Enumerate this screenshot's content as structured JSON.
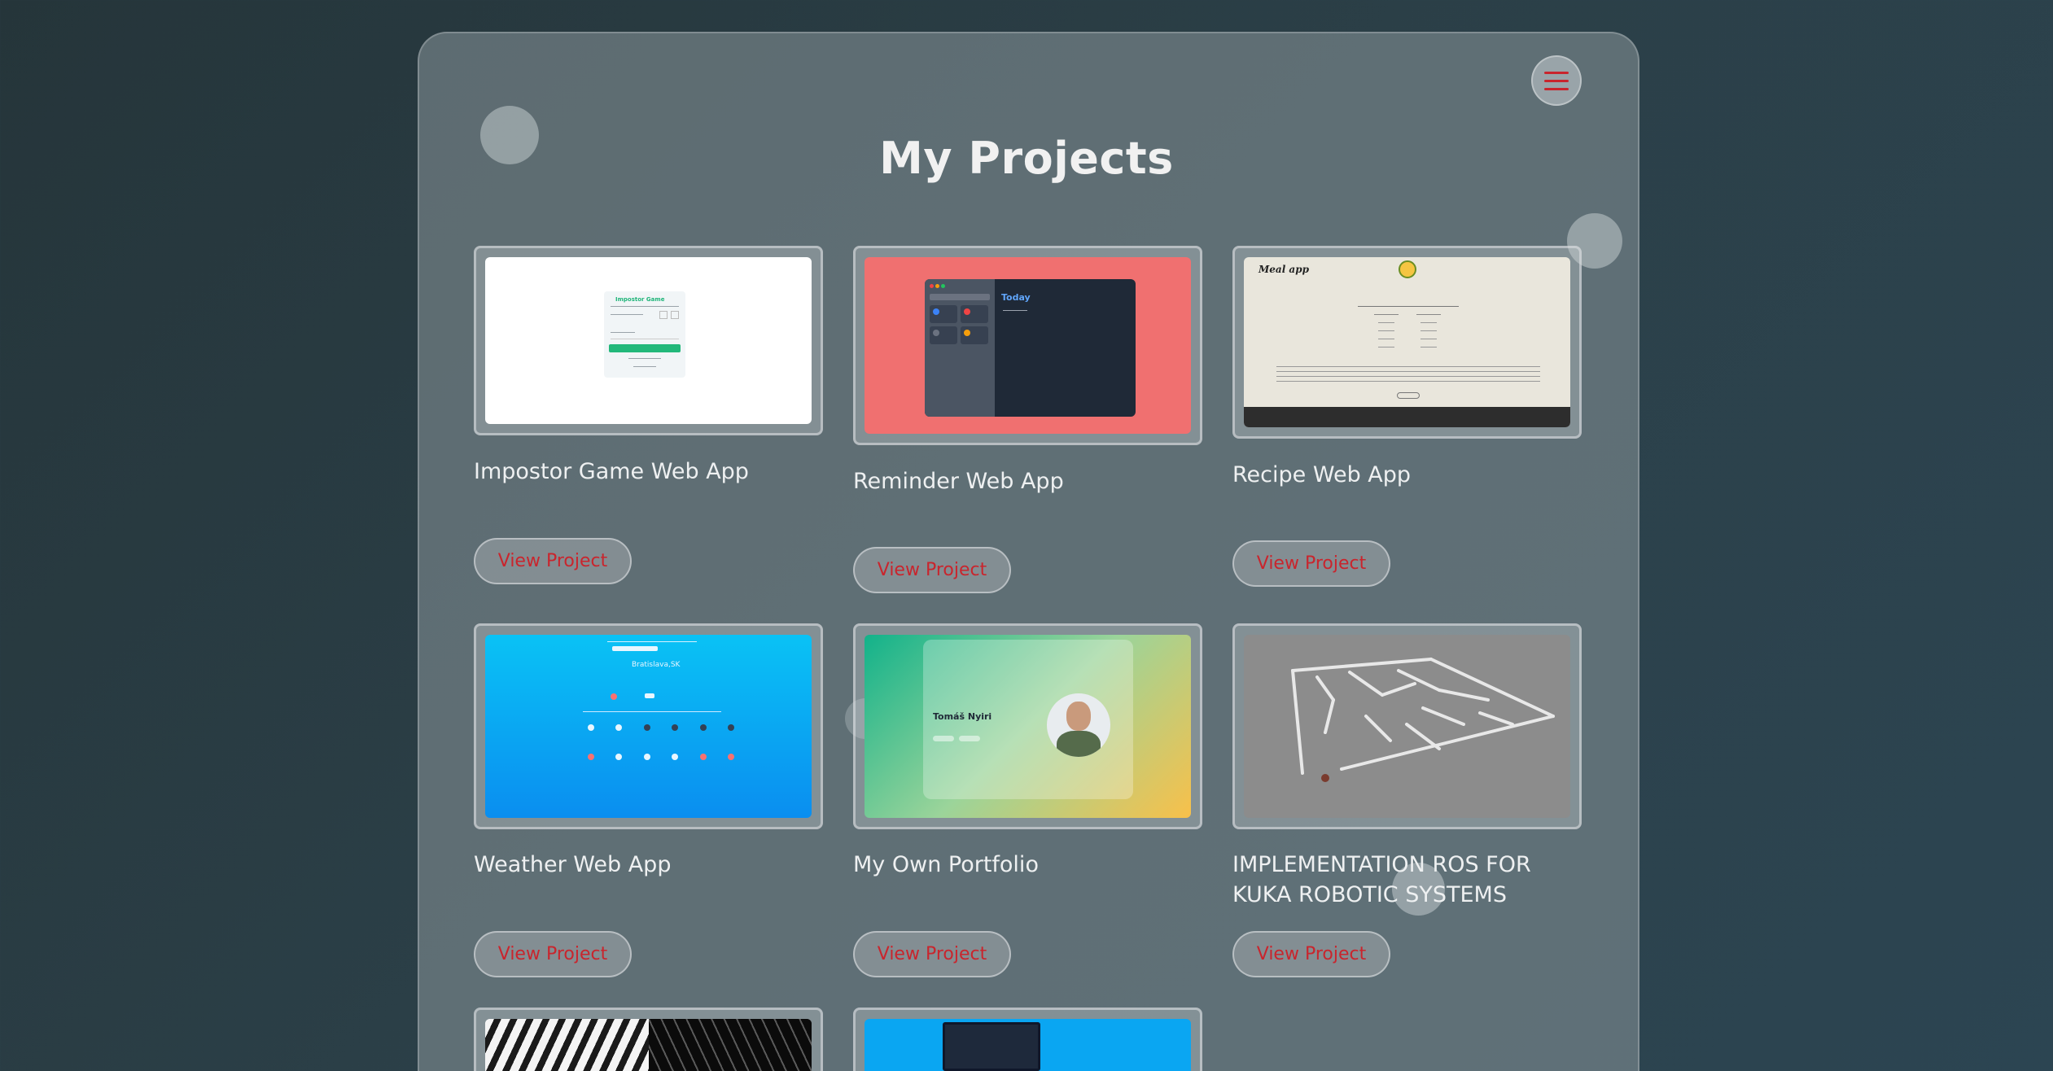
{
  "page": {
    "title": "My Projects"
  },
  "menu": {
    "icon": "hamburger-menu-icon"
  },
  "projects": [
    {
      "title": "Impostor Game Web App",
      "button": "View Project"
    },
    {
      "title": "Reminder Web App",
      "button": "View Project"
    },
    {
      "title": "Recipe Web App",
      "button": "View Project"
    },
    {
      "title": "Weather Web App",
      "button": "View Project"
    },
    {
      "title": "My Own Portfolio",
      "button": "View Project"
    },
    {
      "title": "IMPLEMENTATION ROS FOR KUKA ROBOTIC SYSTEMS",
      "button": "View Project"
    }
  ],
  "thumbs": {
    "impostor_title": "Impostor Game",
    "reminder_today": "Today",
    "recipe_logo": "Meal app",
    "weather_city": "Bratislava,SK",
    "portfolio_name": "Tomáš Nyiri"
  },
  "colors": {
    "accent": "#c9252d",
    "reminder_bg": "#f07070",
    "weather_bg": "#0aa6f2",
    "maze_bg": "#8c8c8c"
  }
}
